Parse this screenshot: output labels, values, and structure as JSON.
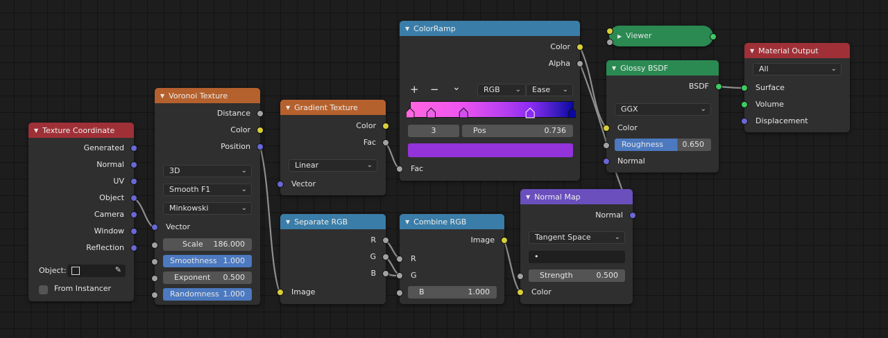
{
  "colors": {
    "frame": "#a03037",
    "texture": "#b5612d",
    "converter": "#3a7da8",
    "shader": "#2a8a52",
    "vector": "#6a4fbd",
    "socket_color": "#d7cf3a",
    "socket_float": "#a2a2a2",
    "socket_vector": "#6968d6",
    "socket_shader": "#3fca62"
  },
  "texture_coordinate": {
    "title": "Texture Coordinate",
    "outputs": [
      "Generated",
      "Normal",
      "UV",
      "Object",
      "Camera",
      "Window",
      "Reflection"
    ],
    "object_label": "Object:",
    "from_instancer": "From Instancer"
  },
  "voronoi": {
    "title": "Voronoi Texture",
    "outputs": [
      "Distance",
      "Color",
      "Position"
    ],
    "dim": "3D",
    "feature": "Smooth F1",
    "metric": "Minkowski",
    "vector_label": "Vector",
    "fields": [
      {
        "label": "Scale",
        "value": "186.000"
      },
      {
        "label": "Smoothness",
        "value": "1.000"
      },
      {
        "label": "Exponent",
        "value": "0.500"
      },
      {
        "label": "Randomness",
        "value": "1.000"
      }
    ]
  },
  "gradient": {
    "title": "Gradient Texture",
    "outputs": [
      "Color",
      "Fac"
    ],
    "type": "Linear",
    "vector_label": "Vector"
  },
  "colorramp": {
    "title": "ColorRamp",
    "outputs": [
      "Color",
      "Alpha"
    ],
    "add": "+",
    "remove": "−",
    "menu": "⌄",
    "mode": "RGB",
    "interp": "Ease",
    "index": "3",
    "pos_label": "Pos",
    "pos_value": "0.736",
    "fac_label": "Fac",
    "selected_color": "#9433d9",
    "stops": [
      0.0,
      0.13,
      0.33,
      0.74,
      1.0
    ]
  },
  "separate": {
    "title": "Separate RGB",
    "outputs": [
      "R",
      "G",
      "B"
    ],
    "image_label": "Image"
  },
  "combine": {
    "title": "Combine RGB",
    "output": "Image",
    "inputs": [
      "R",
      "G"
    ],
    "b_label": "B",
    "b_value": "1.000"
  },
  "normalmap": {
    "title": "Normal Map",
    "output": "Normal",
    "space": "Tangent Space",
    "uvmap": "•",
    "strength_label": "Strength",
    "strength_value": "0.500",
    "color_label": "Color"
  },
  "viewer": {
    "title": "Viewer"
  },
  "glossy": {
    "title": "Glossy BSDF",
    "output": "BSDF",
    "distribution": "GGX",
    "color_label": "Color",
    "roughness_label": "Roughness",
    "roughness_value": "0.650",
    "normal_label": "Normal"
  },
  "material_output": {
    "title": "Material Output",
    "target": "All",
    "inputs": [
      "Surface",
      "Volume",
      "Displacement"
    ]
  }
}
